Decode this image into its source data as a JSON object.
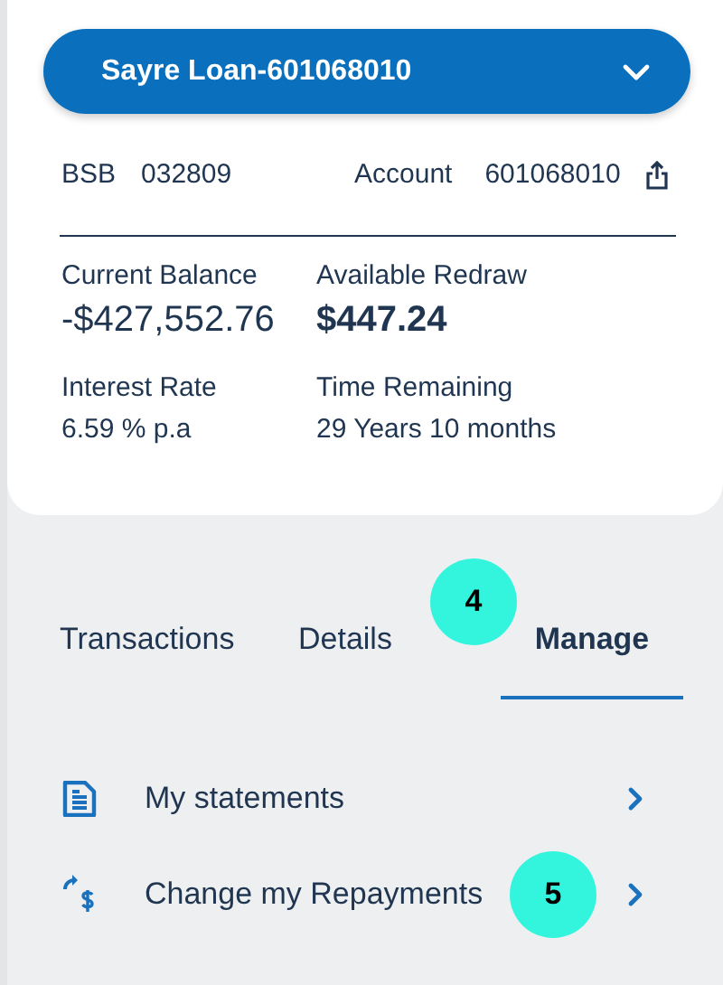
{
  "account_selector": {
    "label": "Sayre Loan-601068010"
  },
  "account_info": {
    "bsb_label": "BSB",
    "bsb": "032809",
    "account_label": "Account",
    "account": "601068010"
  },
  "balances": [
    {
      "label": "Current Balance",
      "value": "-$427,552.76",
      "emphasis": false
    },
    {
      "label": "Available Redraw",
      "value": "$447.24",
      "emphasis": true
    },
    {
      "label": "Interest Rate",
      "value": "6.59 % p.a",
      "emphasis": false
    },
    {
      "label": "Time Remaining",
      "value": "29 Years 10 months",
      "emphasis": false
    }
  ],
  "tabs": [
    {
      "label": "Transactions",
      "selected": false
    },
    {
      "label": "Details",
      "selected": false
    },
    {
      "label": "Manage",
      "selected": true
    }
  ],
  "manage_items": [
    {
      "label": "My statements",
      "kind": "document"
    },
    {
      "label": "Change my Repayments",
      "kind": "repayment"
    }
  ],
  "annotations": [
    {
      "label": "4"
    },
    {
      "label": "5"
    }
  ]
}
